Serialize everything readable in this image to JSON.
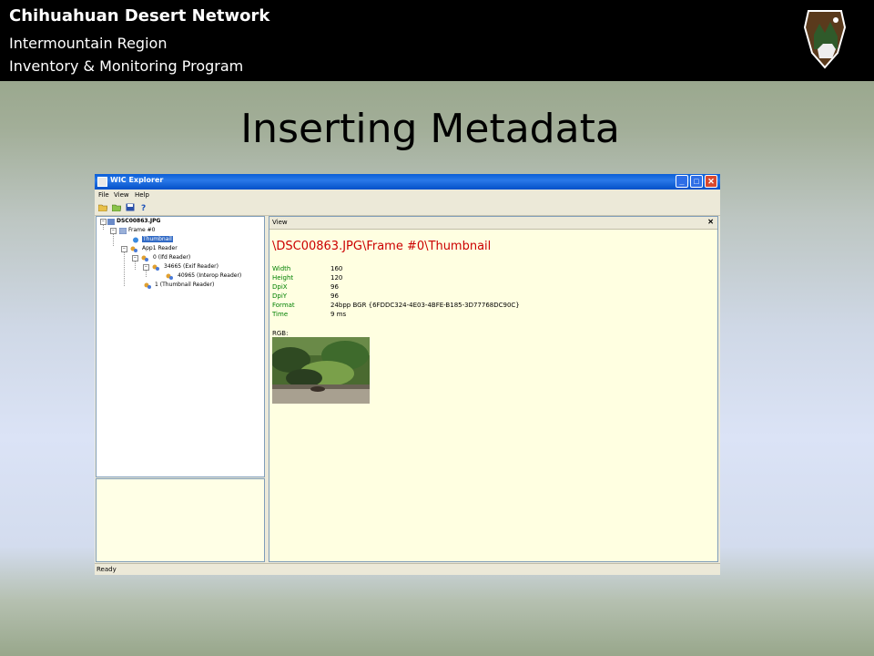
{
  "header": {
    "line1": "Chihuahuan Desert Network",
    "line2": "Intermountain Region",
    "line3": "Inventory & Monitoring Program",
    "logo": "nps-arrowhead-logo"
  },
  "slide_title": "Inserting Metadata",
  "window": {
    "title": "WIC Explorer",
    "menus": [
      "File",
      "View",
      "Help"
    ],
    "tree": {
      "root": "DSC00863.JPG",
      "frame": "Frame #0",
      "thumbnail": "Thumbnail",
      "app1": "App1 Reader",
      "ifd": "0 (Ifd Reader)",
      "exif": "34665 (Exif Reader)",
      "interop": "40965 (Interop Reader)",
      "thumbreader": "1 (Thumbnail Reader)"
    },
    "view": {
      "tab_label": "View",
      "close_glyph": "✕",
      "path": "\\DSC00863.JPG\\Frame #0\\Thumbnail",
      "properties": [
        {
          "key": "Width",
          "value": "160"
        },
        {
          "key": "Height",
          "value": "120"
        },
        {
          "key": "DpiX",
          "value": "96"
        },
        {
          "key": "DpiY",
          "value": "96"
        },
        {
          "key": "Format",
          "value": "24bpp BGR {6FDDC324-4E03-4BFE-B185-3D77768DC90C}"
        },
        {
          "key": "Time",
          "value": "9 ms"
        }
      ],
      "rgb_label": "RGB:"
    },
    "status": "Ready"
  }
}
